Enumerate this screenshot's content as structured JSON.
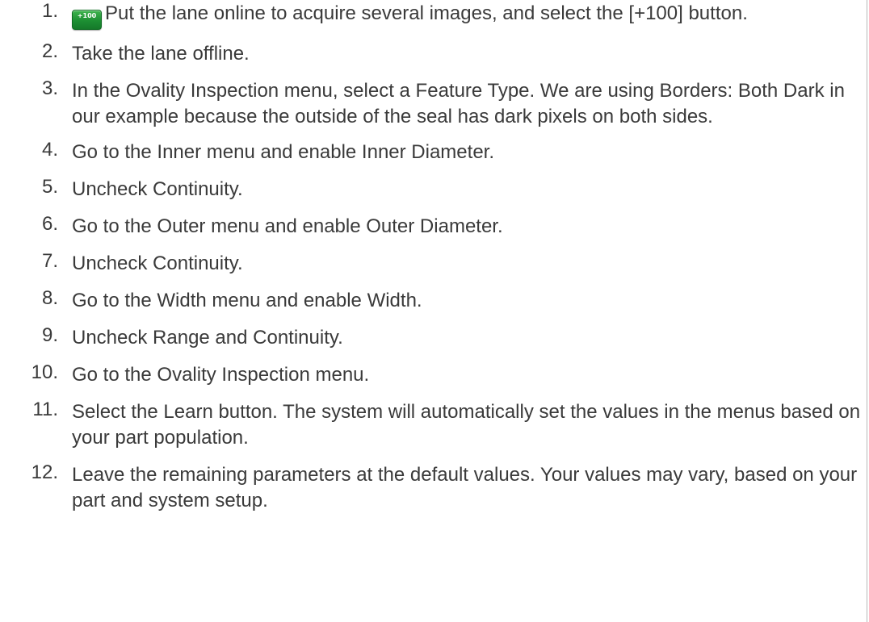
{
  "steps": [
    {
      "num": "1.",
      "icon_label": "+100",
      "icon": "plus-100-button-icon",
      "text": "Put the lane online to acquire several images, and select the [+100] button."
    },
    {
      "num": "2.",
      "text": "Take the lane offline."
    },
    {
      "num": "3.",
      "text": "In the Ovality Inspection menu, select a Feature Type. We are using Borders: Both Dark in our example because the outside of the seal has dark pixels on both sides."
    },
    {
      "num": "4.",
      "text": "Go to the Inner menu and enable Inner Diameter."
    },
    {
      "num": "5.",
      "text": "Uncheck Continuity."
    },
    {
      "num": "6.",
      "text": "Go to the Outer menu and enable Outer Diameter."
    },
    {
      "num": "7.",
      "text": "Uncheck Continuity."
    },
    {
      "num": "8.",
      "text": "Go to the Width menu and enable Width."
    },
    {
      "num": "9.",
      "text": "Uncheck Range and Continuity."
    },
    {
      "num": "10.",
      "text": "Go to the Ovality Inspection menu."
    },
    {
      "num": "11.",
      "text": "Select the Learn button. The system will automatically set the values in the menus based on your part population."
    },
    {
      "num": "12.",
      "text": "Leave the remaining parameters at the default values. Your values may vary, based on your part and system setup."
    }
  ],
  "colors": {
    "text": "#3a3a3a",
    "button_green": "#1d8f33",
    "rule": "#b8b8b8"
  }
}
